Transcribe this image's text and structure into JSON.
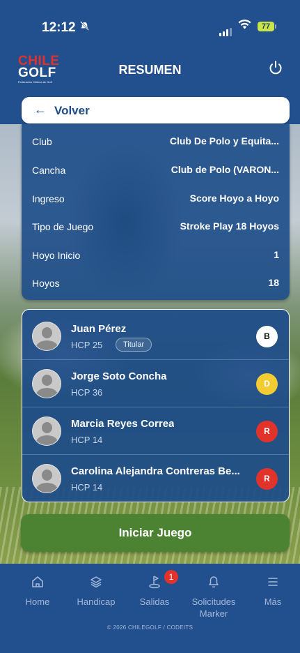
{
  "status_bar": {
    "time": "12:12",
    "battery": "77"
  },
  "header": {
    "logo_line1": "CHILE",
    "logo_line2": "GOLF",
    "logo_tagline": "Federación Chilena de Golf",
    "title": "RESUMEN"
  },
  "back_button": {
    "arrow": "←",
    "label": "Volver"
  },
  "info": [
    {
      "key": "Club",
      "value": "Club De Polo y Equita..."
    },
    {
      "key": "Cancha",
      "value": "Club de Polo (VARON..."
    },
    {
      "key": "Ingreso",
      "value": "Score Hoyo a Hoyo"
    },
    {
      "key": "Tipo de Juego",
      "value": "Stroke Play 18 Hoyos"
    },
    {
      "key": "Hoyo Inicio",
      "value": "1"
    },
    {
      "key": "Hoyos",
      "value": "18"
    }
  ],
  "players": [
    {
      "name": "Juan Pérez",
      "hcp": "HCP 25",
      "badge": "Titular",
      "tee": "B",
      "tee_color": "#ffffff"
    },
    {
      "name": "Jorge Soto Concha",
      "hcp": "HCP 36",
      "tee": "D",
      "tee_color": "#f2cc32"
    },
    {
      "name": "Marcia Reyes Correa",
      "hcp": "HCP 14",
      "tee": "R",
      "tee_color": "#e2332b"
    },
    {
      "name": "Carolina Alejandra Contreras Be...",
      "hcp": "HCP 14",
      "tee": "R",
      "tee_color": "#e2332b"
    }
  ],
  "start_button": {
    "label": "Iniciar Juego"
  },
  "tabs": [
    {
      "label": "Home",
      "icon": "home-icon"
    },
    {
      "label": "Handicap",
      "icon": "layers-icon"
    },
    {
      "label": "Salidas",
      "icon": "golf-icon",
      "badge": "1"
    },
    {
      "label": "Solicitudes Marker",
      "icon": "bell-icon"
    },
    {
      "label": "Más",
      "icon": "menu-icon"
    }
  ],
  "footer": {
    "copyright": "© 2026 CHILEGOLF / CODEITS"
  },
  "colors": {
    "primary": "#22508f",
    "accent_red": "#e2332b",
    "start_green": "#4b8333",
    "tee_yellow": "#f2cc32"
  }
}
